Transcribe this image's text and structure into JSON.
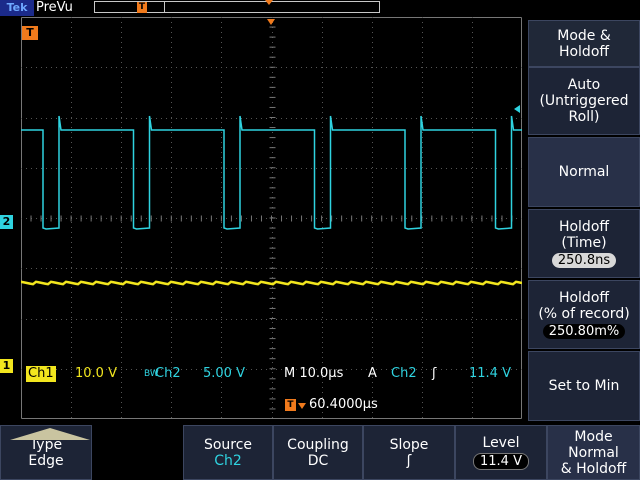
{
  "topbar": {
    "brand": "Tek",
    "acq_mode": "PreVu",
    "record_trigger_marker": "T"
  },
  "markers": {
    "trigger_pos": "T",
    "ch2_ground": "2",
    "ch1_ground": "1"
  },
  "readouts": {
    "ch1_label": "Ch1",
    "ch1_scale": "10.0 V",
    "ch2_bw": "BW",
    "ch2_label": "Ch2",
    "ch2_scale": "5.00 V",
    "timebase": "M 10.0µs",
    "trigger_type": "A",
    "trigger_source": "Ch2",
    "trigger_slope": "ʃ",
    "trigger_level": "11.4 V",
    "delay_icon": "T",
    "delay_value": "60.4000µs"
  },
  "side_menu": {
    "title": "Mode & Holdoff",
    "auto_line1": "Auto",
    "auto_line2": "(Untriggered",
    "auto_line3": "Roll)",
    "normal": "Normal",
    "holdoff_time_line1": "Holdoff",
    "holdoff_time_line2": "(Time)",
    "holdoff_time_value": "250.8ns",
    "holdoff_pct_line1": "Holdoff",
    "holdoff_pct_line2": "(% of record)",
    "holdoff_pct_value": "250.80m%",
    "set_to_min": "Set to Min"
  },
  "bottom_menu": {
    "type_line1": "Type",
    "type_line2": "Edge",
    "source_line1": "Source",
    "source_line2": "Ch2",
    "coupling_line1": "Coupling",
    "coupling_line2": "DC",
    "slope_line1": "Slope",
    "slope_line2": "ʃ",
    "level_line1": "Level",
    "level_line2": "11.4 V",
    "mode_line1": "Mode",
    "mode_line2": "Normal",
    "mode_line3": "& Holdoff"
  },
  "colors": {
    "ch1": "#f2e61e",
    "ch2": "#2fd3e0",
    "trigger": "#f07a1c",
    "menu_bg": "#1d2436"
  }
}
